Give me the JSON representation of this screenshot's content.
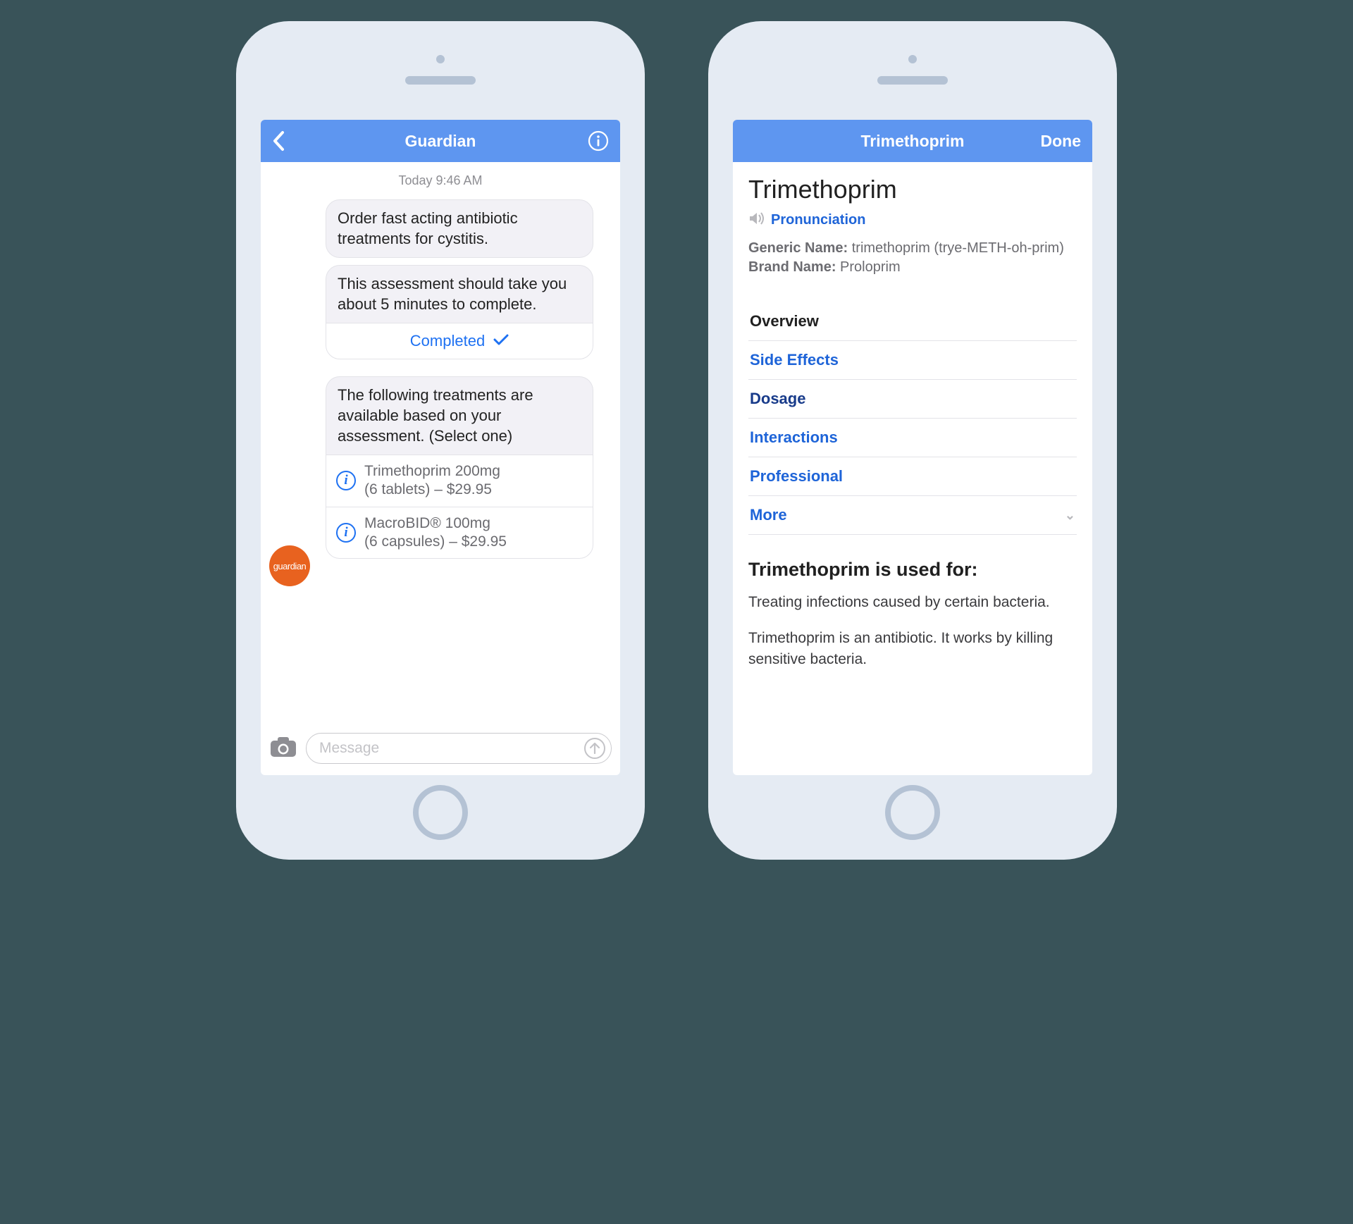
{
  "left": {
    "nav": {
      "title": "Guardian"
    },
    "timestamp": "Today 9:46 AM",
    "msg1": "Order fast acting antibiotic treatments for cystitis.",
    "msg2": "This assessment should take you about 5 minutes to complete.",
    "completed_label": "Completed",
    "msg3": "The following treatments are available based on your assessment. (Select one)",
    "options": [
      {
        "line1": "Trimethoprim 200mg",
        "line2": "(6 tablets) – $29.95"
      },
      {
        "line1": "MacroBID® 100mg",
        "line2": "(6 capsules) – $29.95"
      }
    ],
    "avatar_label": "guardian",
    "input_placeholder": "Message"
  },
  "right": {
    "nav": {
      "title": "Trimethoprim",
      "done": "Done"
    },
    "title": "Trimethoprim",
    "pronunciation_label": "Pronunciation",
    "generic_label": "Generic Name:",
    "generic_value": "trimethoprim (trye-METH-oh-prim)",
    "brand_label": "Brand Name:",
    "brand_value": "Proloprim",
    "tabs": {
      "overview": "Overview",
      "side_effects": "Side Effects",
      "dosage": "Dosage",
      "interactions": "Interactions",
      "professional": "Professional",
      "more": "More"
    },
    "section_heading": "Trimethoprim is used for:",
    "para1": "Treating infections caused by certain bacteria.",
    "para2": "Trimethoprim is an antibiotic. It works by killing sensitive bacteria."
  }
}
